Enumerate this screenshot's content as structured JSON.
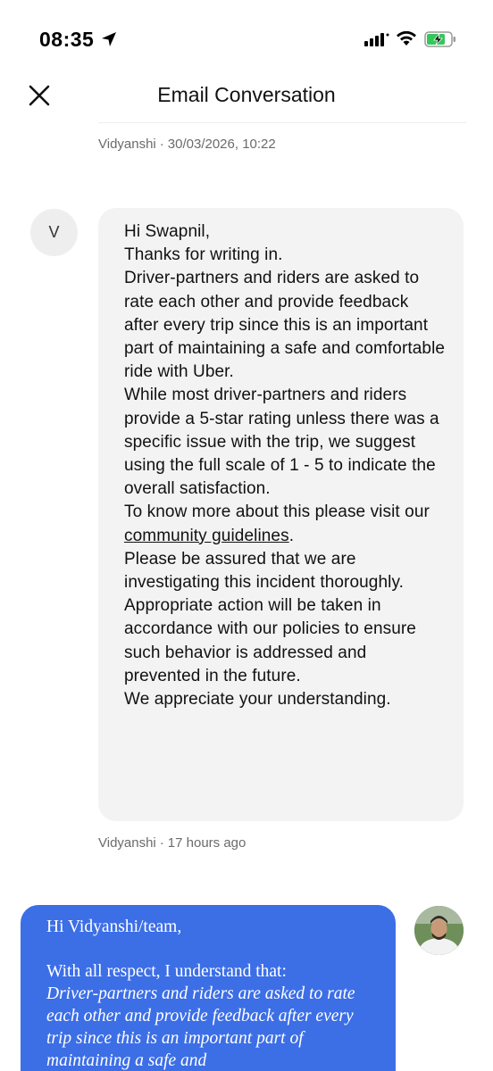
{
  "status_bar": {
    "time": "08:35"
  },
  "header": {
    "title": "Email Conversation"
  },
  "messages": [
    {
      "sender": "Vidyanshi",
      "timestamp": "30/03/2026, 10:22"
    },
    {
      "sender": "Vidyanshi",
      "avatar_initial": "V",
      "timestamp": "17 hours ago",
      "lines": {
        "l1": "Hi Swapnil,",
        "l2": "Thanks for writing in.",
        "p3": "Driver-partners and riders are asked to rate each other and provide feedback after every trip since this is an important part of maintaining a safe and comfortable ride with Uber.",
        "p4": "While most driver-partners and riders provide a 5-star rating unless there was a specific issue with the trip, we suggest using the full scale of 1 - 5 to indicate the overall satisfaction.",
        "p5_pre": "To know more about this please visit our ",
        "p5_link": "community guidelines",
        "p5_post": ".",
        "p6": "Please be assured that we are investigating this incident thoroughly. Appropriate action will be taken in accordance with our policies to ensure such behavior is addressed and prevented in the future.",
        "p7": "We appreciate your understanding."
      }
    },
    {
      "sender": "user",
      "lines": {
        "l1": "Hi Vidyanshi/team,",
        "l2": "With all respect, I understand that:",
        "quote": "Driver-partners and riders are asked to rate each other and provide feedback after every trip since this is an important part of maintaining a safe and"
      }
    }
  ],
  "colors": {
    "user_bubble": "#3c6ee6",
    "agent_bubble": "#f3f3f3",
    "battery_fill": "#34c759"
  },
  "icons": {
    "close": "close-icon",
    "location": "location-arrow-icon",
    "signal": "cellular-signal-icon",
    "wifi": "wifi-icon",
    "battery": "battery-charging-icon"
  }
}
